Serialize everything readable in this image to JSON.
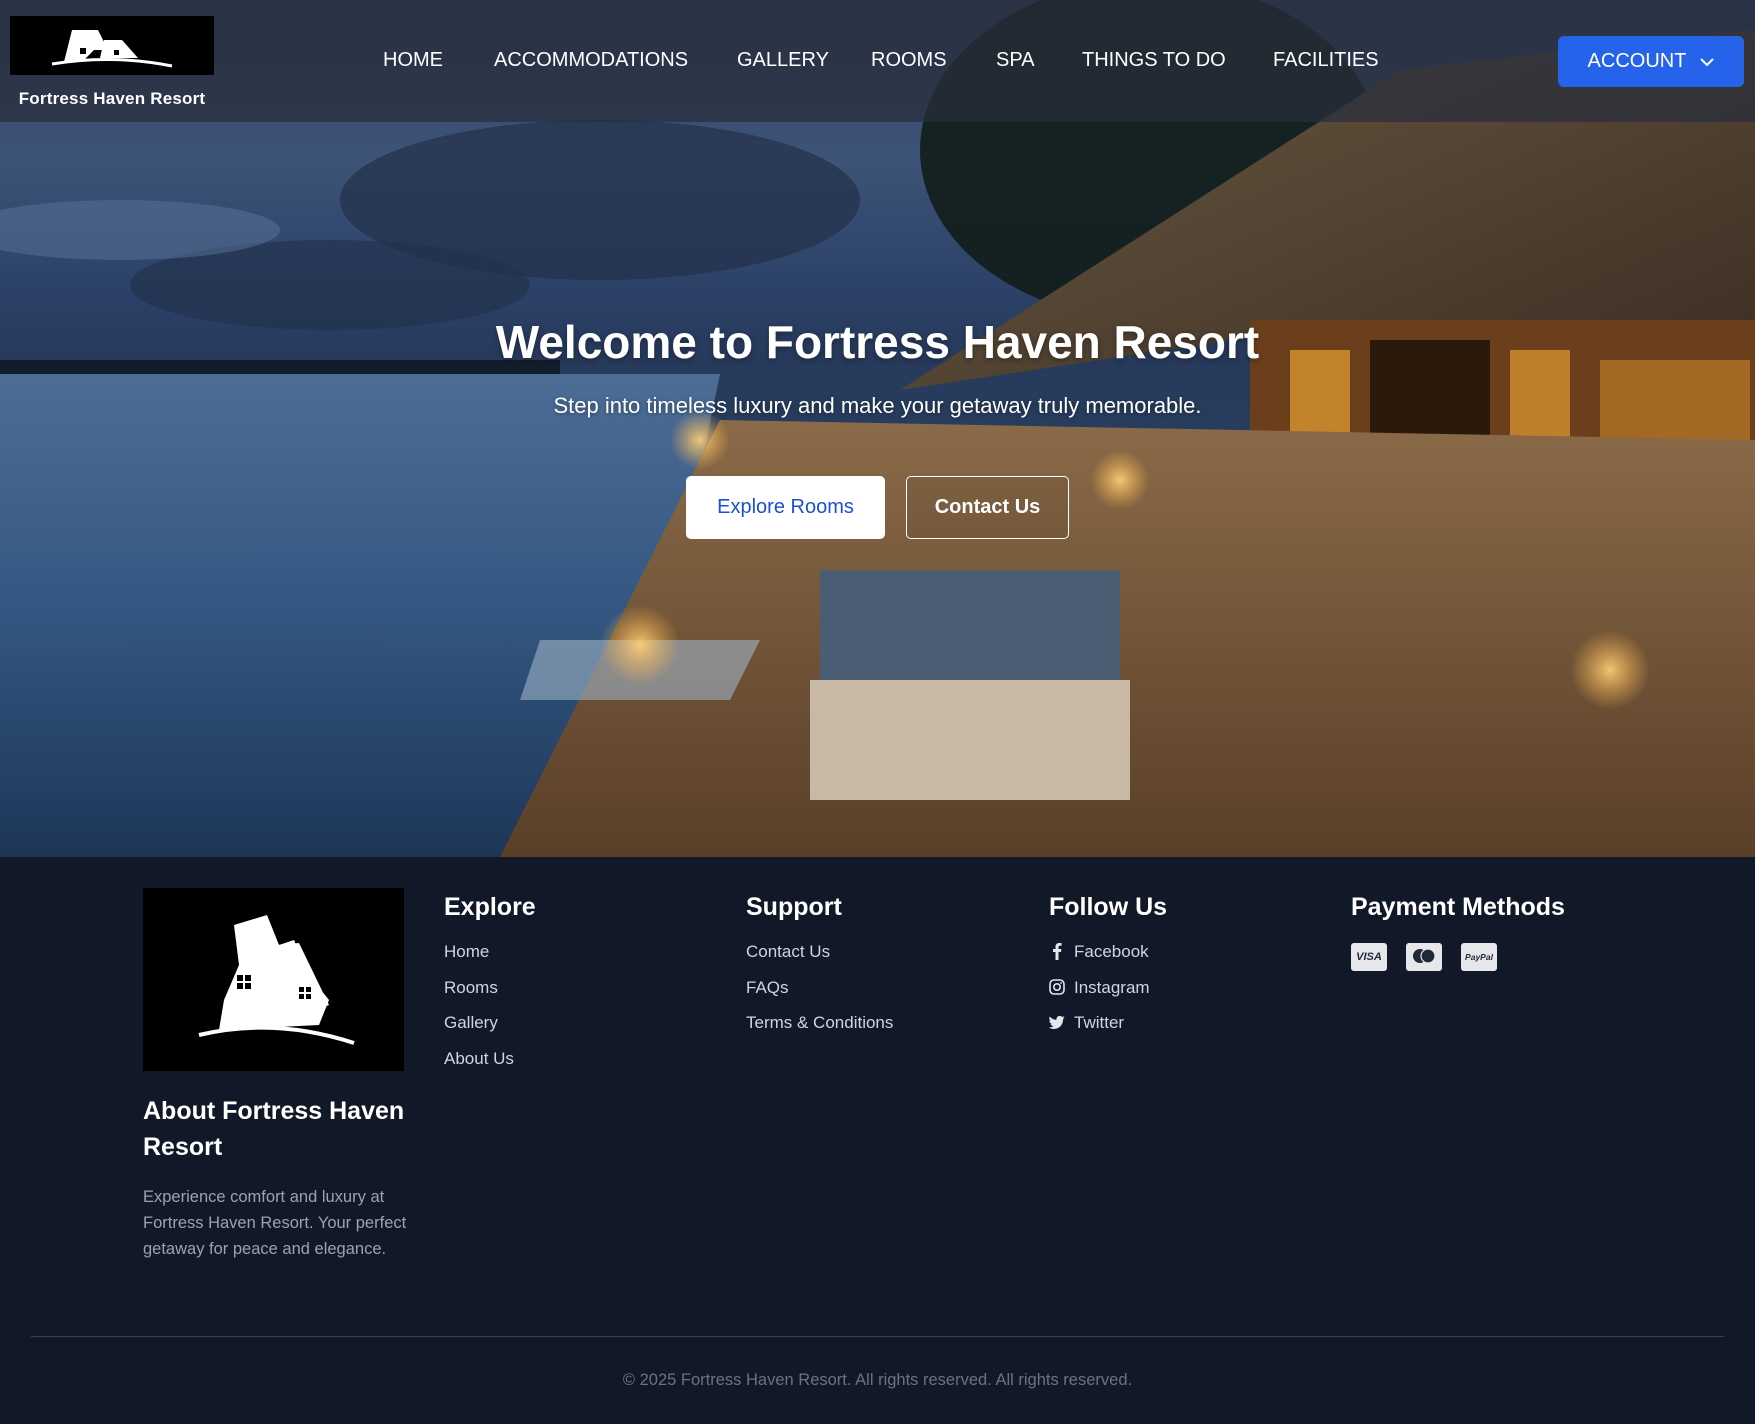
{
  "brand": {
    "name": "Fortress Haven Resort",
    "logo_icon": "house-logo-icon"
  },
  "nav": {
    "links": [
      "HOME",
      "ACCOMMODATIONS",
      "GALLERY",
      "ROOMS",
      "SPA",
      "THINGS TO DO",
      "FACILITIES"
    ],
    "account_label": "ACCOUNT",
    "account_icon": "chevron-down-icon"
  },
  "hero": {
    "title": "Welcome to Fortress Haven Resort",
    "subtitle": "Step into timeless luxury and make your getaway truly memorable.",
    "primary_button": "Explore Rooms",
    "secondary_button": "Contact Us"
  },
  "footer": {
    "about": {
      "heading": "About Fortress Haven Resort",
      "text": "Experience comfort and luxury at Fortress Haven Resort. Your perfect getaway for peace and elegance."
    },
    "explore": {
      "heading": "Explore",
      "links": [
        "Home",
        "Rooms",
        "Gallery",
        "About Us"
      ]
    },
    "support": {
      "heading": "Support",
      "links": [
        "Contact Us",
        "FAQs",
        "Terms & Conditions"
      ]
    },
    "follow": {
      "heading": "Follow Us",
      "links": [
        {
          "label": "Facebook",
          "icon": "facebook-icon"
        },
        {
          "label": "Instagram",
          "icon": "instagram-icon"
        },
        {
          "label": "Twitter",
          "icon": "twitter-icon"
        }
      ]
    },
    "payment": {
      "heading": "Payment Methods",
      "methods": [
        "VISA",
        "mastercard",
        "PayPal"
      ]
    },
    "copyright": "© 2025 Fortress Haven Resort. All rights reserved. All rights reserved."
  },
  "colors": {
    "accent": "#2563eb",
    "footer_bg": "#111827",
    "nav_bg": "#282e3c"
  }
}
